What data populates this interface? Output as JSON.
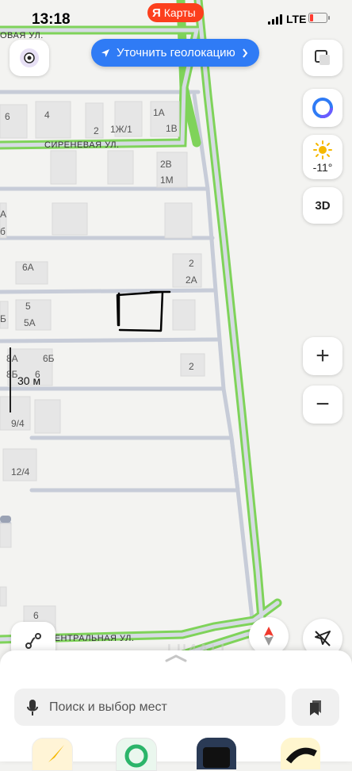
{
  "status_bar": {
    "time": "13:18",
    "app_badge": "Карты",
    "app_badge_letter": "Я",
    "network": "LTE"
  },
  "map": {
    "streets": [
      "СИРЕНЕВАЯ УЛ.",
      "ЦЕНТРАЛЬНАЯ УЛ.",
      "ОВАЯ УЛ."
    ],
    "house_numbers": [
      "6",
      "4",
      "2",
      "1Ж/1",
      "1А",
      "1В",
      "2В",
      "1М",
      "6А",
      "2",
      "2А",
      "5",
      "5А",
      "6Б",
      "8А",
      "8Б",
      "6",
      "2",
      "9/4",
      "12/4",
      "6",
      "Б",
      "А",
      "б",
      "П"
    ],
    "scale": "30 м"
  },
  "controls": {
    "geolocation_button": "Уточнить геолокацию",
    "weather_temp": "-11°",
    "view_3d": "3D",
    "zoom_in": "+",
    "zoom_out": "−"
  },
  "bottom_sheet": {
    "search_placeholder": "Поиск и выбор мест"
  },
  "colors": {
    "accent": "#2f7bf5",
    "road_green": "#7fd35a",
    "yandex_red": "#fc3f1d"
  }
}
